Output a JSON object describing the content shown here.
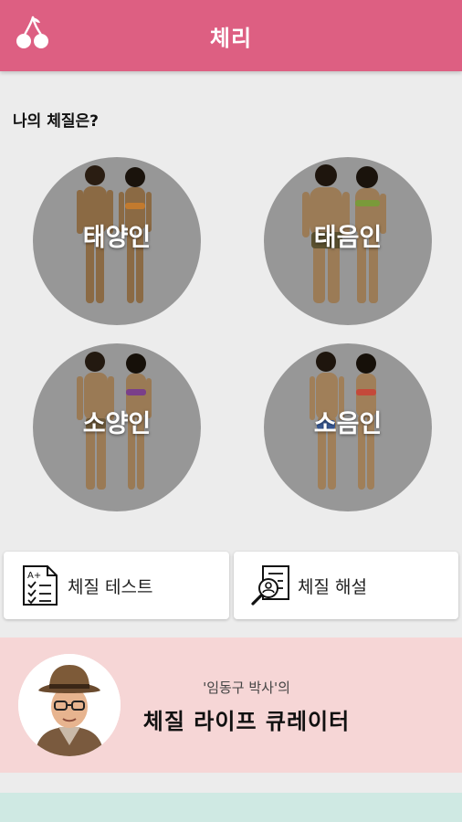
{
  "appbar": {
    "title": "체리",
    "logo_icon": "cherry-icon"
  },
  "section": {
    "title": "나의 체질은?"
  },
  "types": [
    {
      "label": "태양인"
    },
    {
      "label": "태음인"
    },
    {
      "label": "소양인"
    },
    {
      "label": "소음인"
    }
  ],
  "menu": {
    "test_label": "체질 테스트",
    "test_icon": "checklist-icon",
    "explain_label": "체질 해설",
    "explain_icon": "magnifier-document-icon"
  },
  "banner": {
    "subtitle": "'임동구 박사'의",
    "title": "체질 라이프 큐레이터"
  },
  "colors": {
    "appbar": "#dd5f82",
    "banner": "#f6d6d6",
    "circle": "#979797",
    "bottom_strip": "#cfe9e3"
  }
}
